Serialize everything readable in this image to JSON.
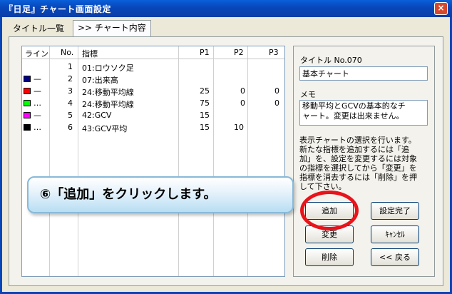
{
  "window": {
    "title": "『日足』チャート画面設定",
    "close_label": "×"
  },
  "tabs": [
    {
      "label": "タイトル一覧"
    },
    {
      "label": ">> チャート内容"
    }
  ],
  "indicator_table": {
    "headers": {
      "line": "ライン",
      "no": "No.",
      "indicator": "指標",
      "p1": "P1",
      "p2": "P2",
      "p3": "P3"
    },
    "rows": [
      {
        "color": "",
        "style": "",
        "no": "1",
        "indicator": "01:ロウソク足",
        "p1": "",
        "p2": "",
        "p3": ""
      },
      {
        "color": "#000080",
        "style": "—",
        "no": "2",
        "indicator": "07:出来高",
        "p1": "",
        "p2": "",
        "p3": ""
      },
      {
        "color": "#ff0000",
        "style": "—",
        "no": "3",
        "indicator": "24:移動平均線",
        "p1": "25",
        "p2": "0",
        "p3": "0"
      },
      {
        "color": "#00ff00",
        "style": "…",
        "no": "4",
        "indicator": "24:移動平均線",
        "p1": "75",
        "p2": "0",
        "p3": "0"
      },
      {
        "color": "#ff00ff",
        "style": "—",
        "no": "5",
        "indicator": "42:GCV",
        "p1": "15",
        "p2": "",
        "p3": ""
      },
      {
        "color": "#000000",
        "style": "…",
        "no": "6",
        "indicator": "43:GCV平均",
        "p1": "15",
        "p2": "10",
        "p3": ""
      }
    ]
  },
  "title_section": {
    "label": "タイトル No.070",
    "value": "基本チャート"
  },
  "memo_section": {
    "label": "メモ",
    "line1": "移動平均とGCVの基本的なチ",
    "line2": "ャート。変更は出来ません。"
  },
  "instructions": {
    "line1": "表示チャートの選択を行います。",
    "line2": "新たな指標を追加するには「追",
    "line3": "加」を、設定を変更するには対象",
    "line4": "の指標を選択してから「変更」を",
    "line5": "指標を消去するには「削除」を押",
    "line6": "して下さい。"
  },
  "buttons": {
    "add": "追加",
    "finish": "設定完了",
    "change": "変更",
    "cancel": "ｷｬﾝｾﾙ",
    "delete": "削除",
    "back": "<< 戻る"
  },
  "callout": {
    "text": "⑥「追加」をクリックします。"
  }
}
